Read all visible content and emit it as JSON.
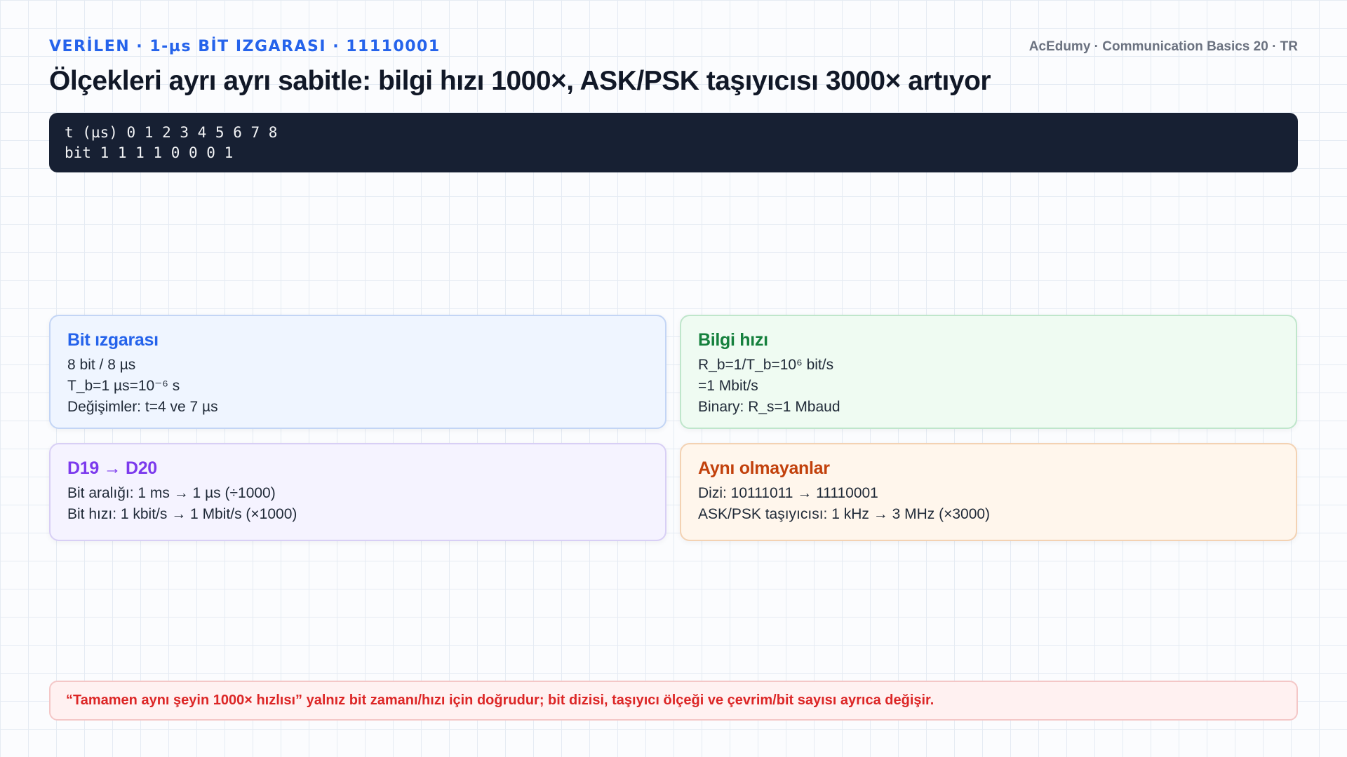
{
  "header": {
    "kicker": "VERİLEN · 1-µs BİT IZGARASI · 11110001",
    "brand": "AcEdumy · Communication Basics 20 · TR",
    "title": "Ölçekleri ayrı ayrı sabitle: bilgi hızı 1000×, ASK/PSK taşıyıcısı 3000× artıyor"
  },
  "code_block": {
    "lines": [
      "t (µs) 0 1 2 3 4 5 6 7 8",
      "bit 1 1 1 1 0 0 0 1"
    ]
  },
  "cards": {
    "bit_grid": {
      "title": "Bit ızgarası",
      "lines": [
        "8 bit / 8 µs",
        "T_b=1 µs=10⁻⁶ s",
        "Değişimler: t=4 ve 7 µs"
      ],
      "color": "#2563eb"
    },
    "info_rate": {
      "title": "Bilgi hızı",
      "lines": [
        "R_b=1/T_b=10⁶ bit/s",
        "=1 Mbit/s",
        "Binary: R_s=1 Mbaud"
      ],
      "color": "#15803d"
    },
    "d19_d20": {
      "title": "D19 → D20",
      "lines": [
        "Bit aralığı: 1 ms → 1 µs (÷1000)",
        "Bit hızı: 1 kbit/s → 1 Mbit/s (×1000)"
      ],
      "color": "#7c3aed"
    },
    "not_same": {
      "title": "Aynı olmayanlar",
      "lines": [
        "Dizi: 10111011 → 11110001",
        "ASK/PSK taşıyıcısı: 1 kHz → 3 MHz (×3000)"
      ],
      "color": "#c2410c"
    }
  },
  "note": {
    "text": "“Tamamen aynı şeyin 1000× hızlısı” yalnız bit zamanı/hızı için doğrudur; bit dizisi, taşıyıcı ölçeği ve çevrim/bit sayısı ayrıca değişir.",
    "color": "#dc2626"
  }
}
